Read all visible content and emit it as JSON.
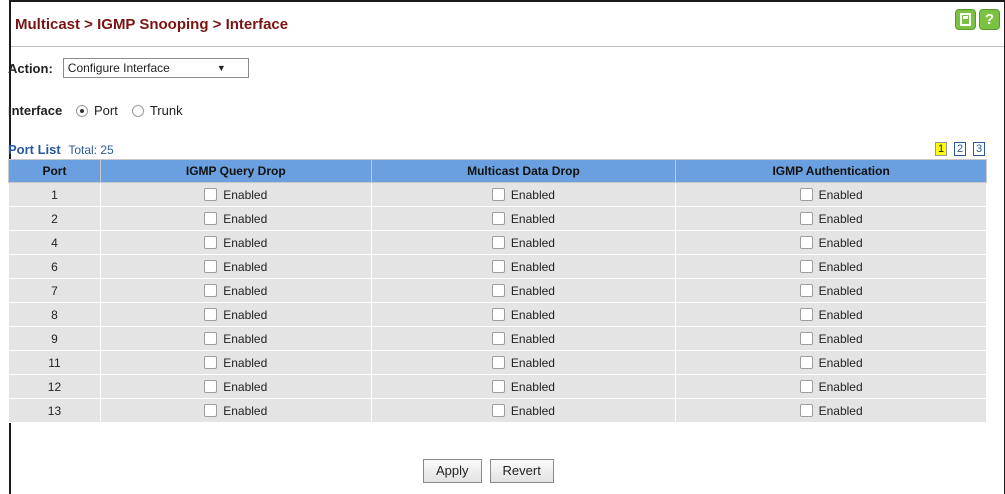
{
  "header": {
    "title": "Multicast > IGMP Snooping > Interface",
    "save_icon": "save-icon",
    "help_icon": "help-icon",
    "help_glyph": "?"
  },
  "action": {
    "label": "Action:",
    "selected": "Configure Interface",
    "arrow": "▼"
  },
  "interface": {
    "label": "Interface",
    "options": [
      "Port",
      "Trunk"
    ],
    "selected": "Port"
  },
  "port_list": {
    "title": "Port List",
    "total": "Total: 25",
    "pages": [
      "1",
      "2",
      "3"
    ],
    "current_page": "1"
  },
  "table": {
    "headers": [
      "Port",
      "IGMP Query Drop",
      "Multicast Data Drop",
      "IGMP Authentication"
    ],
    "checkbox_label": "Enabled",
    "rows": [
      {
        "port": "1"
      },
      {
        "port": "2"
      },
      {
        "port": "4"
      },
      {
        "port": "6"
      },
      {
        "port": "7"
      },
      {
        "port": "8"
      },
      {
        "port": "9"
      },
      {
        "port": "11"
      },
      {
        "port": "12"
      },
      {
        "port": "13"
      }
    ]
  },
  "buttons": {
    "apply": "Apply",
    "revert": "Revert"
  },
  "colors": {
    "title": "#7a1414",
    "header_bg": "#6aa0e0",
    "row_bg": "#e4e4e4",
    "icon_green": "#7cc242",
    "link": "#2a5a9a"
  }
}
